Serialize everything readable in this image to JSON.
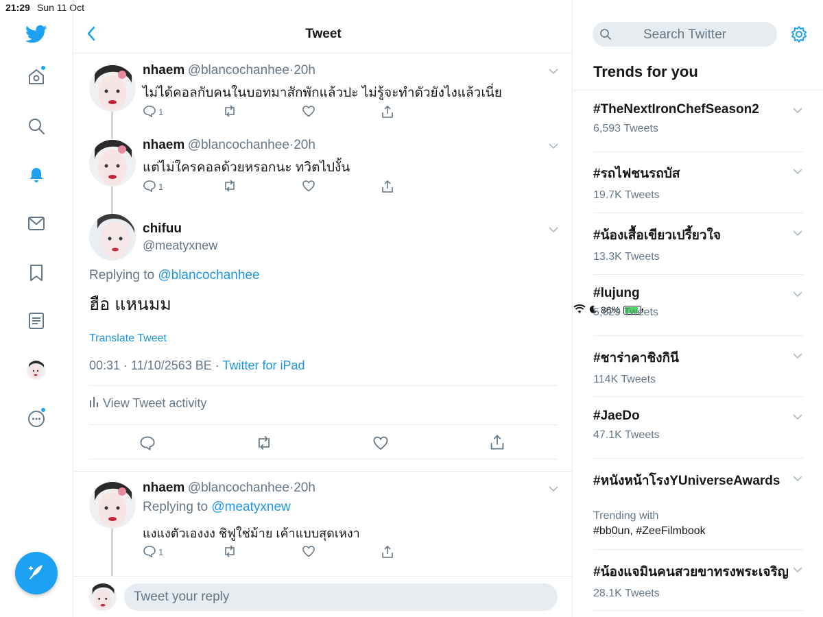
{
  "status": {
    "time": "21:29",
    "date": "Sun 11 Oct",
    "battery": "86%",
    "battery_level": 0.86
  },
  "header": {
    "title": "Tweet"
  },
  "thread": [
    {
      "name": "nhaem",
      "handle": "@blancochanhee",
      "age": "20h",
      "text": "ไม่ได้คอลกับคนในบอทมาสักพักแล้วปะ ไม่รู้จะทำตัวยังไงแล้วเนี่ย",
      "reply_count": "1"
    },
    {
      "name": "nhaem",
      "handle": "@blancochanhee",
      "age": "20h",
      "text": "แต่ไม่ใครคอลด้วยหรอกนะ ทวิตไปงั้น",
      "reply_count": "1"
    }
  ],
  "focus": {
    "name": "chifuu",
    "handle": "@meatyxnew",
    "replying_prefix": "Replying to",
    "replying_to": "@blancochanhee",
    "text": "ฮือ แหนมม",
    "translate": "Translate Tweet",
    "timestamp": "00:31 · 11/10/2563 BE ·",
    "source": "Twitter for iPad",
    "activity": "View Tweet activity"
  },
  "reply": {
    "name": "nhaem",
    "handle": "@blancochanhee",
    "age": "20h",
    "replying_prefix": "Replying to",
    "replying_to": "@meatyxnew",
    "text": "แงแงตัวเองงง ชิฟูใช่ม้าย เค้าแบบสุดเหงา",
    "reply_count": "1"
  },
  "reply_box": {
    "placeholder": "Tweet your reply"
  },
  "search": {
    "placeholder": "Search Twitter"
  },
  "trends": {
    "title": "Trends for you",
    "items": [
      {
        "name": "#TheNextIronChefSeason2",
        "count": "6,593 Tweets"
      },
      {
        "name": "#รถไฟชนรถบัส",
        "count": "19.7K Tweets"
      },
      {
        "name": "#น้องเสื้อเขียวเปรี้ยวใจ",
        "count": "13.3K Tweets"
      },
      {
        "name": "#lujung",
        "count": "5,629 Tweets"
      },
      {
        "name": "#ชาร่าคาชิงกินี",
        "count": "114K Tweets"
      },
      {
        "name": "#JaeDo",
        "count": "47.1K Tweets"
      },
      {
        "name": "#หนังหน้าโรงYUniverseAwards",
        "count": "",
        "trending_with_label": "Trending with",
        "trending_with": "#bb0un, #ZeeFilmbook"
      },
      {
        "name": "#น้องแจมินคนสวยขาทรงพระเจริญ",
        "count": "28.1K Tweets"
      }
    ]
  },
  "colors": {
    "accent": "#1da1f2",
    "link": "#1b95e0",
    "muted": "#657786",
    "border": "#e6ecf0"
  },
  "icons": [
    "twitter-bird-icon",
    "home-icon",
    "search-icon",
    "bell-icon",
    "mail-icon",
    "bookmark-icon",
    "lists-icon",
    "more-icon",
    "compose-icon",
    "back-icon",
    "gear-icon",
    "chevron-down-icon",
    "reply-icon",
    "retweet-icon",
    "like-icon",
    "share-icon",
    "bar-chart-icon"
  ]
}
